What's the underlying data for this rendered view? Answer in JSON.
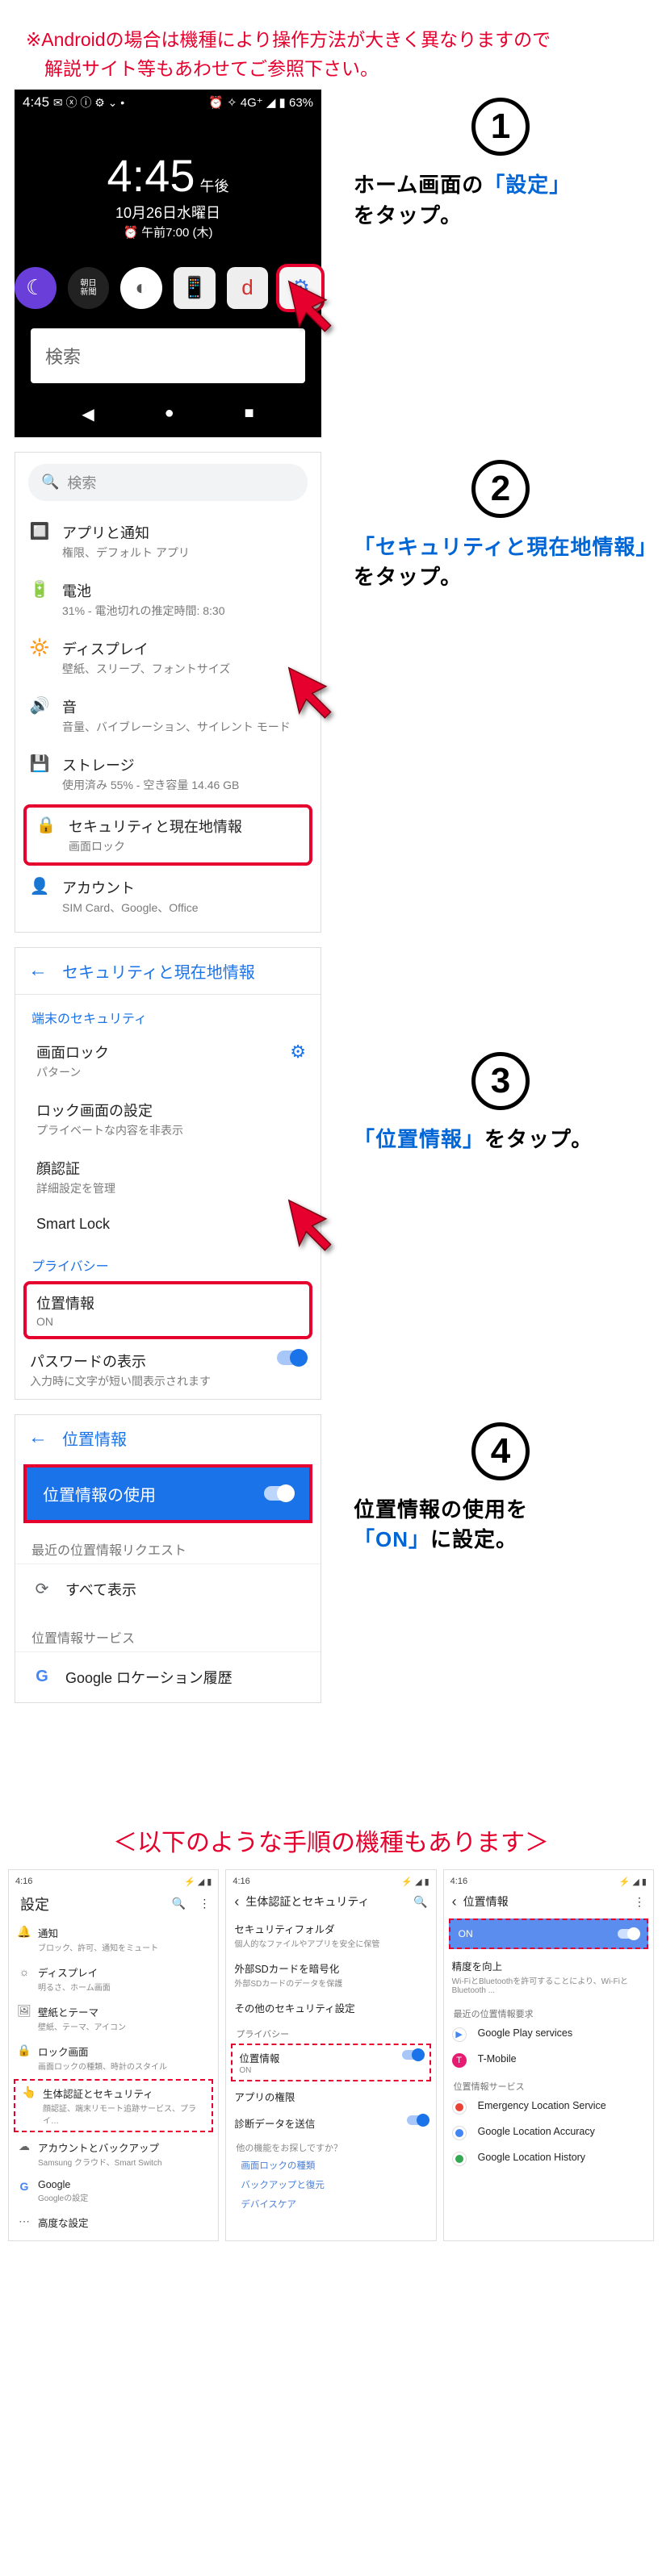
{
  "warning_line1": "※Androidの場合は機種により操作方法が大きく異なりますので",
  "warning_line2_indent": "　解説サイト等もあわせてご参照下さい。",
  "step1": {
    "num": "1",
    "text_pre": "ホーム画面の",
    "text_hl": "「設定」",
    "text_post": "をタップ。",
    "status_left": "4:45",
    "status_icons_left": "✉ ⓧ ⓘ ⚙ ⌄ •",
    "status_icons_right": "⏰ ✧ 4G⁺ ◢ ▮ 63%",
    "clock": "4:45",
    "ampm": "午後",
    "date1": "10月26日水曜日",
    "date2": "午前7:00 (木)",
    "search_label": "検索",
    "nav_back": "◀",
    "nav_home": "●",
    "nav_recent": "■"
  },
  "step2": {
    "num": "2",
    "text_hl": "「セキュリティと現在地情報」",
    "text_post": "をタップ。",
    "search": "検索",
    "items": [
      {
        "icon": "apps",
        "t1": "アプリと通知",
        "t2": "権限、デフォルト アプリ"
      },
      {
        "icon": "battery",
        "t1": "電池",
        "t2": "31% - 電池切れの推定時間: 8:30"
      },
      {
        "icon": "display",
        "t1": "ディスプレイ",
        "t2": "壁紙、スリープ、フォントサイズ"
      },
      {
        "icon": "sound",
        "t1": "音",
        "t2": "音量、バイブレーション、サイレント モード"
      },
      {
        "icon": "storage",
        "t1": "ストレージ",
        "t2": "使用済み 55% - 空き容量 14.46 GB"
      },
      {
        "icon": "security",
        "t1": "セキュリティと現在地情報",
        "t2": "画面ロック",
        "hl": true
      },
      {
        "icon": "account",
        "t1": "アカウント",
        "t2": "SIM Card、Google、Office"
      }
    ]
  },
  "step3": {
    "num": "3",
    "text_hl": "「位置情報」",
    "text_post": "をタップ。",
    "header": "セキュリティと現在地情報",
    "sub1": "端末のセキュリティ",
    "items1": [
      {
        "t1": "画面ロック",
        "t2": "パターン",
        "gear": true
      },
      {
        "t1": "ロック画面の設定",
        "t2": "プライベートな内容を非表示"
      },
      {
        "t1": "顔認証",
        "t2": "詳細設定を管理"
      },
      {
        "t1": "Smart Lock"
      }
    ],
    "sub2": "プライバシー",
    "location": {
      "t1": "位置情報",
      "t2": "ON"
    },
    "pw": {
      "t1": "パスワードの表示",
      "t2": "入力時に文字が短い間表示されます"
    }
  },
  "step4": {
    "num": "4",
    "text_pre": "位置情報の使用を",
    "text_hl": "「ON」",
    "text_post": "に設定。",
    "header": "位置情報",
    "use": "位置情報の使用",
    "recent": "最近の位置情報リクエスト",
    "showall": "すべて表示",
    "svc": "位置情報サービス",
    "ghistory": "Google ロケーション履歴"
  },
  "alt_title": "＜以下のような手順の機種もあります＞",
  "alt_a": {
    "time": "4:16",
    "hdr": "設定",
    "items": [
      {
        "ic": "bell",
        "m1": "通知",
        "m2": "ブロック、許可、通知をミュート"
      },
      {
        "ic": "disp",
        "m1": "ディスプレイ",
        "m2": "明るさ、ホーム画面"
      },
      {
        "ic": "wall",
        "m1": "壁紙とテーマ",
        "m2": "壁紙、テーマ、アイコン"
      },
      {
        "ic": "lock",
        "m1": "ロック画面",
        "m2": "画面ロックの種類、時計のスタイル"
      },
      {
        "ic": "bio",
        "m1": "生体認証とセキュリティ",
        "m2": "顔認証、端末リモート追跡サービス、プライ…",
        "dashed": true
      },
      {
        "ic": "acct",
        "m1": "アカウントとバックアップ",
        "m2": "Samsung クラウド、Smart Switch"
      },
      {
        "ic": "g",
        "m1": "Google",
        "m2": "Googleの設定"
      },
      {
        "ic": "adv",
        "m1": "高度な設定",
        "m2": ""
      }
    ]
  },
  "alt_b": {
    "time": "4:16",
    "hdr": "生体認証とセキュリティ",
    "items": [
      {
        "m1": "セキュリティフォルダ",
        "m2": "個人的なファイルやアプリを安全に保管"
      },
      {
        "m1": "外部SDカードを暗号化",
        "m2": "外部SDカードのデータを保護"
      },
      {
        "m1": "その他のセキュリティ設定",
        "m2": ""
      }
    ],
    "sub": "プライバシー",
    "loc": {
      "m1": "位置情報",
      "m2": "ON",
      "dashed": true
    },
    "perm": "アプリの権限",
    "diag": "診断データを送信",
    "ask": "他の機能をお探しですか？",
    "links": [
      "画面ロックの種類",
      "バックアップと復元",
      "デバイスケア"
    ]
  },
  "alt_c": {
    "time": "4:16",
    "hdr": "位置情報",
    "on": "ON",
    "acc": {
      "m1": "精度を向上",
      "m2": "Wi-FiとBluetoothを許可することにより、Wi-Fiと Bluetooth ..."
    },
    "sub": "最近の位置情報要求",
    "svcsub": "位置情報サービス",
    "items": [
      {
        "ic": "play",
        "m1": "Google Play services"
      },
      {
        "ic": "tm",
        "m1": "T-Mobile"
      },
      {
        "ic": "els",
        "m1": "Emergency Location Service"
      },
      {
        "ic": "gla",
        "m1": "Google Location Accuracy"
      },
      {
        "ic": "glh",
        "m1": "Google Location History"
      }
    ]
  }
}
